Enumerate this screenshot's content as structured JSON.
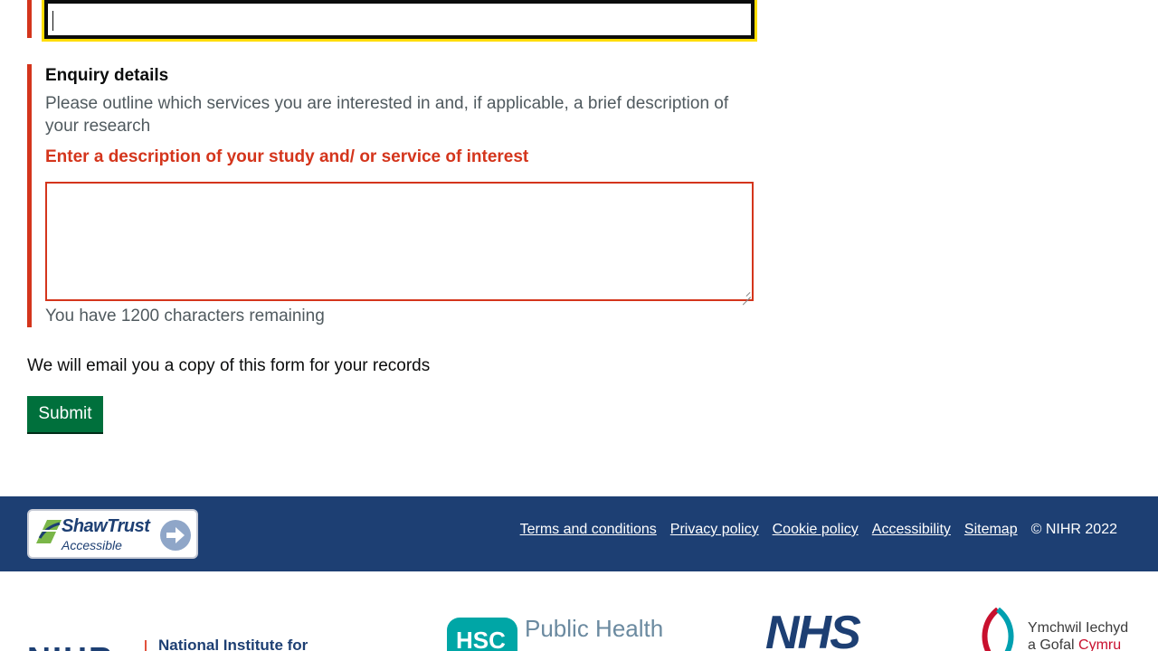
{
  "form": {
    "enquiry": {
      "label": "Enquiry details",
      "hint": "Please outline which services you are interested in and, if applicable, a brief description of your research",
      "error": "Enter a description of your study and/ or service of interest",
      "value": "",
      "counter": "You have 1200 characters remaining"
    },
    "email_note": "We will email you a copy of this form for your records",
    "submit_label": "Submit"
  },
  "footer": {
    "badge": {
      "title": "ShawTrust",
      "subtitle": "Accessible"
    },
    "links": [
      "Terms and conditions",
      "Privacy policy",
      "Cookie policy",
      "Accessibility",
      "Sitemap"
    ],
    "copyright": "© NIHR 2022"
  },
  "partners": {
    "nihr": {
      "mark": "NIHR",
      "text": "National Institute for"
    },
    "hsc": {
      "badge": "HSC",
      "text": "Public Health"
    },
    "nhs": "NHS",
    "ymchwil": {
      "line1": "Ymchwil Iechyd",
      "line2_a": "a Gofal ",
      "line2_b": "Cymru"
    }
  },
  "colors": {
    "error": "#d4351c",
    "focus": "#ffdd00",
    "submit": "#00703c",
    "footer": "#1d3f73"
  }
}
